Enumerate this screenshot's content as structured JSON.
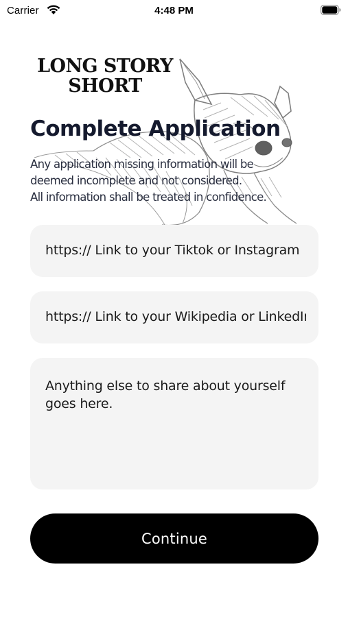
{
  "status_bar": {
    "carrier": "Carrier",
    "time": "4:48 PM",
    "wifi_icon": "wifi-icon",
    "battery_icon": "battery-icon"
  },
  "brand": {
    "line1": "LONG STORY",
    "line2": "SHORT",
    "illustration": "chihuahua-illustration"
  },
  "page": {
    "title": "Complete Application",
    "notice_lines": [
      "Any application missing information will be",
      "deemed incomplete and not considered.",
      "All information shall be treated in confidence."
    ]
  },
  "form": {
    "social_link_placeholder": "https:// Link to your Tiktok or Instagram",
    "profile_link_placeholder": "https:// Link to your Wikipedia or LinkedIn",
    "about_placeholder": "Anything else to share about yourself goes here."
  },
  "actions": {
    "continue_label": "Continue"
  },
  "colors": {
    "title": "#151a2e",
    "field_bg": "#f4f4f4",
    "button_bg": "#000000",
    "button_text": "#ffffff"
  }
}
